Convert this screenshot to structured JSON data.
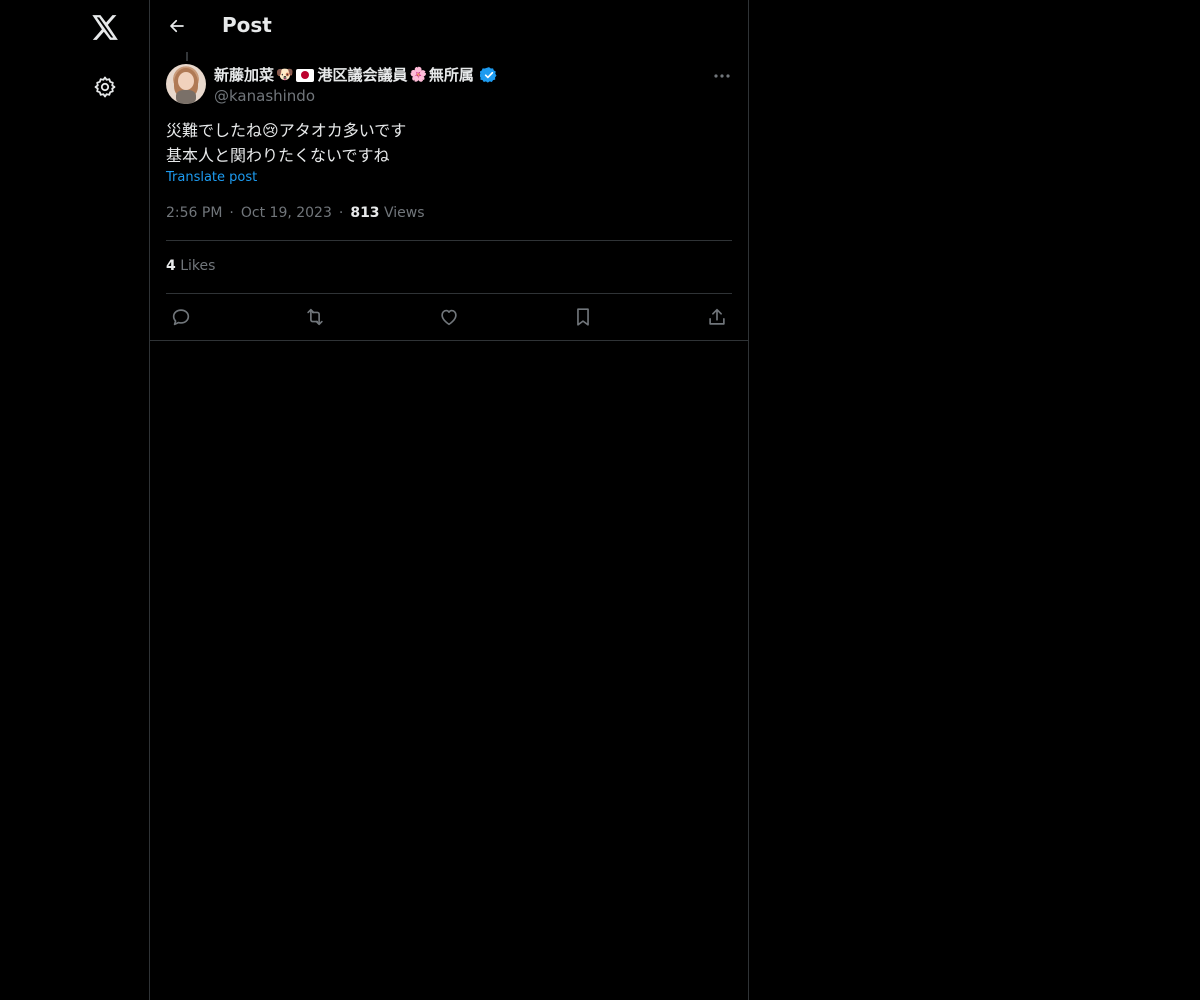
{
  "header": {
    "title": "Post"
  },
  "nav": {
    "logo_icon": "x-logo-icon",
    "settings_icon": "gear-icon"
  },
  "post": {
    "author": {
      "name_part1": "新藤加菜",
      "name_emoji1": "🐶",
      "name_part2": "港区議会議員",
      "name_emoji2": "🌸",
      "name_part3": "無所属",
      "handle": "@kanashindo",
      "verified_color": "#1d9bf0"
    },
    "text_line1_a": "災難でしたね",
    "text_emoji": "😢",
    "text_line1_b": "アタオカ多いです",
    "text_line2": "基本人と関わりたくないですね",
    "translate_label": "Translate post",
    "time": "2:56 PM",
    "date": "Oct 19, 2023",
    "views_count": "813",
    "views_label": "Views",
    "separator": "·",
    "likes_count": "4",
    "likes_label": "Likes"
  },
  "colors": {
    "background": "#000000",
    "text": "#e7e9ea",
    "muted": "#71767b",
    "accent": "#1d9bf0",
    "border": "#2f3336"
  }
}
